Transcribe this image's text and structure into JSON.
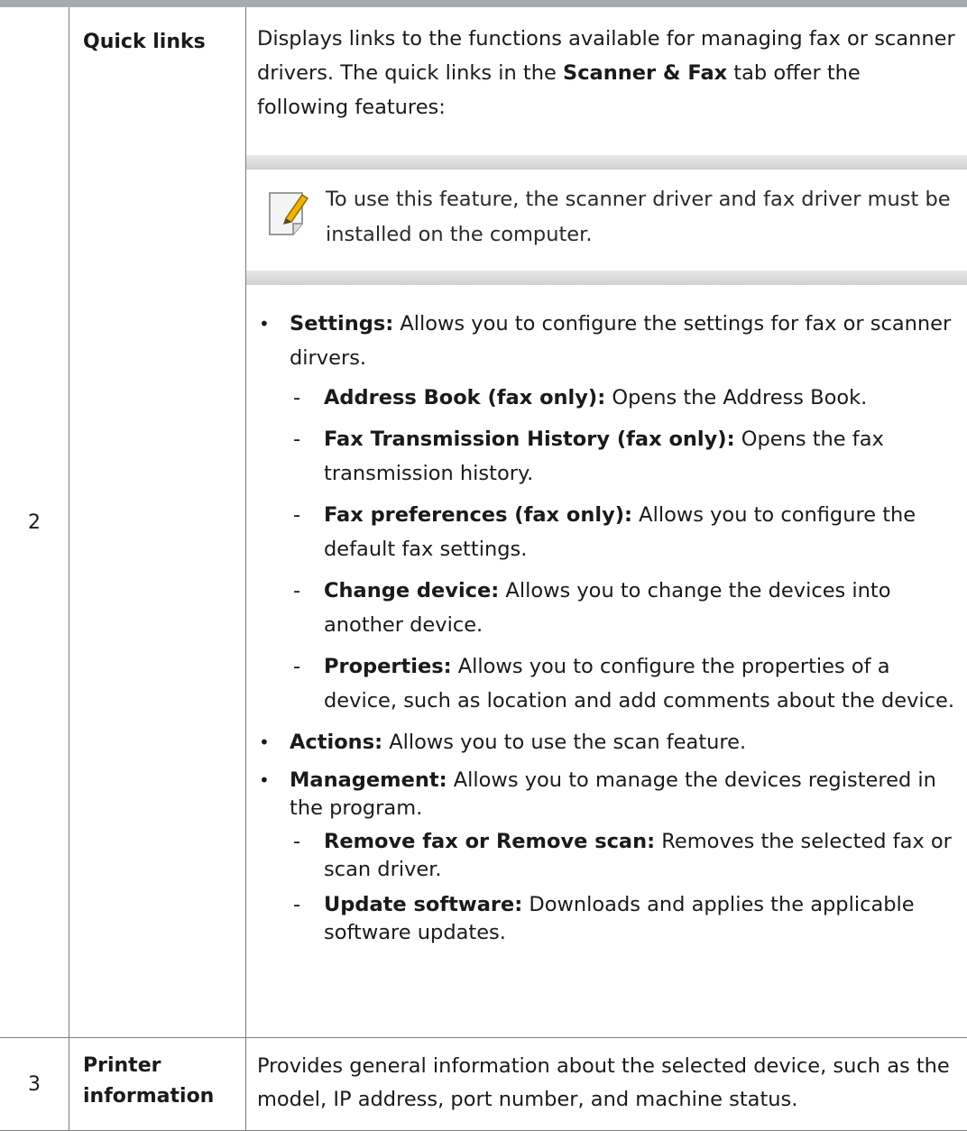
{
  "rows": [
    {
      "number": "2",
      "name": "Quick links",
      "intro": {
        "before": "Displays links to the functions available for managing fax or scanner drivers. The quick links in the ",
        "bold": "Scanner & Fax",
        "after": " tab offer the following features:"
      },
      "note": "To use this feature, the scanner driver and fax driver must be installed on the computer.",
      "features": [
        {
          "label": "Settings:",
          "text": " Allows you to configure the settings for fax or scanner dirvers.",
          "sub": [
            {
              "label": "Address Book (fax only):",
              "text": " Opens the Address Book."
            },
            {
              "label": "Fax Transmission History (fax only):",
              "text": " Opens the fax transmission history."
            },
            {
              "label": "Fax preferences (fax only):",
              "text": " Allows you to configure the default fax settings."
            },
            {
              "label": "Change device:",
              "text": " Allows you to change the devices into another device."
            },
            {
              "label": "Properties:",
              "text": " Allows you to configure the properties of a device, such as location and add comments about the device."
            }
          ]
        },
        {
          "label": "Actions:",
          "text": " Allows you to use the scan feature."
        },
        {
          "label": "Management:",
          "text": " Allows you to manage the devices registered in the program.",
          "sub": [
            {
              "label": "Remove  fax or Remove scan:",
              "text": " Removes the selected fax or scan driver."
            },
            {
              "label": "Update software:",
              "text": " Downloads and applies the applicable software updates."
            }
          ]
        }
      ]
    },
    {
      "number": "3",
      "name_line1": "Printer",
      "name_line2": "information",
      "description": "Provides general information about the selected device, such as the model, IP address, port number, and machine status."
    }
  ],
  "icons": {
    "note": "note-pencil-icon"
  },
  "colors": {
    "top_rule": "#a7abaf",
    "note_band": "#d6d7d8",
    "pencil": "#f0b400"
  }
}
